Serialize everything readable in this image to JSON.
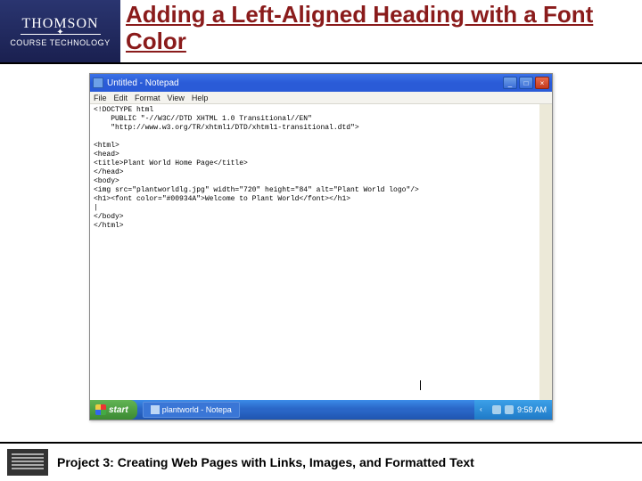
{
  "brand": {
    "line1": "THOMSON",
    "line2": "COURSE TECHNOLOGY"
  },
  "slide": {
    "title": "Adding a Left-Aligned Heading with a Font Color"
  },
  "notepad": {
    "title": "Untitled - Notepad",
    "menu": {
      "file": "File",
      "edit": "Edit",
      "format": "Format",
      "view": "View",
      "help": "Help"
    },
    "code": "<!DOCTYPE html\n    PUBLIC \"-//W3C//DTD XHTML 1.0 Transitional//EN\"\n    \"http://www.w3.org/TR/xhtml1/DTD/xhtml1-transitional.dtd\">\n\n<html>\n<head>\n<title>Plant World Home Page</title>\n</head>\n<body>\n<img src=\"plantworldlg.jpg\" width=\"720\" height=\"84\" alt=\"Plant World logo\"/>\n<h1><font color=\"#00934A\">Welcome to Plant World</font></h1>\n|\n</body>\n</html>"
  },
  "taskbar": {
    "start": "start",
    "task1": "plantworld - Notepa",
    "time": "9:58 AM"
  },
  "footer": {
    "text": "Project 3: Creating Web Pages with Links, Images, and Formatted Text"
  }
}
